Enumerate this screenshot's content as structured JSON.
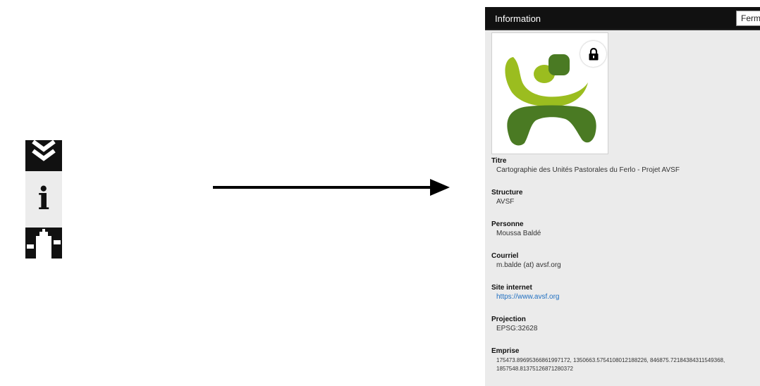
{
  "toolbar": {
    "buttons": [
      {
        "icon": "layers-chevrons-icon"
      },
      {
        "icon": "info-icon",
        "glyph": "i"
      },
      {
        "icon": "tool-icon"
      }
    ]
  },
  "panel": {
    "title": "Information",
    "close_label": "Fermer",
    "logo_icon": "avsf-logo",
    "lock_icon": "lock-icon",
    "fields": [
      {
        "label": "Titre",
        "value": "Cartographie des Unités Pastorales du Ferlo - Projet AVSF"
      },
      {
        "label": "Structure",
        "value": "AVSF"
      },
      {
        "label": "Personne",
        "value": "Moussa Baldé"
      },
      {
        "label": "Courriel",
        "value": "m.balde (at) avsf.org"
      },
      {
        "label": "Site internet",
        "value": "https://www.avsf.org"
      },
      {
        "label": "Projection",
        "value": "EPSG:32628"
      },
      {
        "label": "Emprise",
        "value": "175473.89695366861997172, 1350663.5754108012188226, 846875.72184384311549368, 1857548.81375126871280372"
      }
    ]
  },
  "colors": {
    "header_bg": "#111111",
    "panel_bg": "#ebebeb",
    "logo_light_green": "#9bbd1f",
    "logo_dark_green": "#4a7a23",
    "link": "#1f6fc1"
  }
}
